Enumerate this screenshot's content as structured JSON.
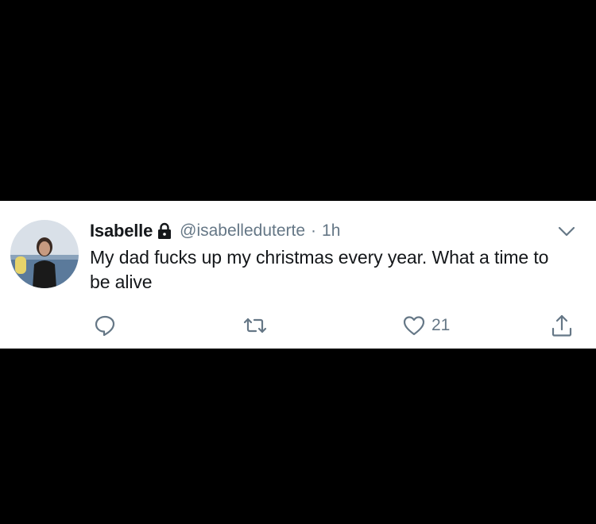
{
  "tweet": {
    "display_name": "Isabelle",
    "handle": "@isabelleduterte",
    "separator": "·",
    "timestamp": "1h",
    "text": "My dad fucks up my christmas every year. What a time to be alive",
    "like_count": "21"
  },
  "icons": {
    "lock": "lock-icon",
    "caret": "chevron-down-icon",
    "reply": "reply-icon",
    "retweet": "retweet-icon",
    "like": "heart-icon",
    "share": "share-icon"
  },
  "colors": {
    "background": "#000000",
    "card": "#ffffff",
    "text_primary": "#14171a",
    "text_secondary": "#657786"
  }
}
